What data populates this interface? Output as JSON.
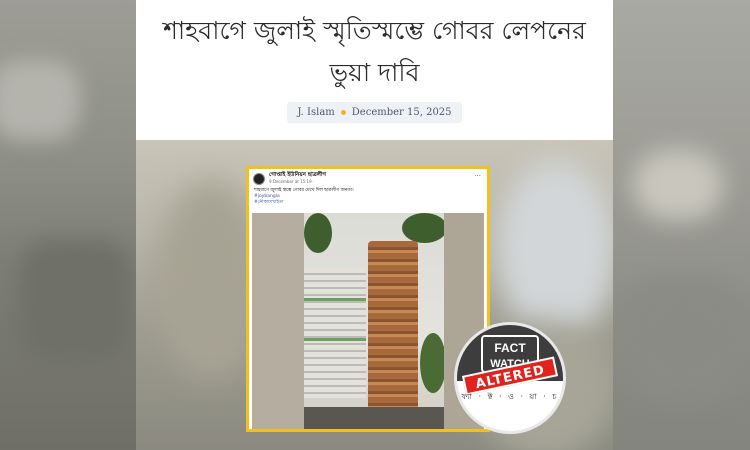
{
  "article": {
    "title": "শাহবাগে জুলাই স্মৃতিস্মম্ভে গোবর লেপনের ভুয়া দাবি",
    "author": "J. Islam",
    "date": "December 15, 2025"
  },
  "post": {
    "page_name": "গোপ্তাই ইউনিয়ন ছাত্রলীগ",
    "timestamp": "9 December at 15:19 · ",
    "text": "শাহবাগে জুলাই স্তম্ভে গোবর মেখে দিল ছাত্রলীগ জনতা।",
    "hashtags": [
      "#joybangla",
      "#নৌকাদেখাইতা"
    ]
  },
  "badge": {
    "brand": "FACT WATCH",
    "verdict": "ALTERED",
    "bottom_text": "ফ্যা · ক্ট · ও · য়া · চ"
  },
  "colors": {
    "frame": "#f2c21b",
    "verdict": "#e0231d",
    "meta_dot": "#f0b429"
  }
}
